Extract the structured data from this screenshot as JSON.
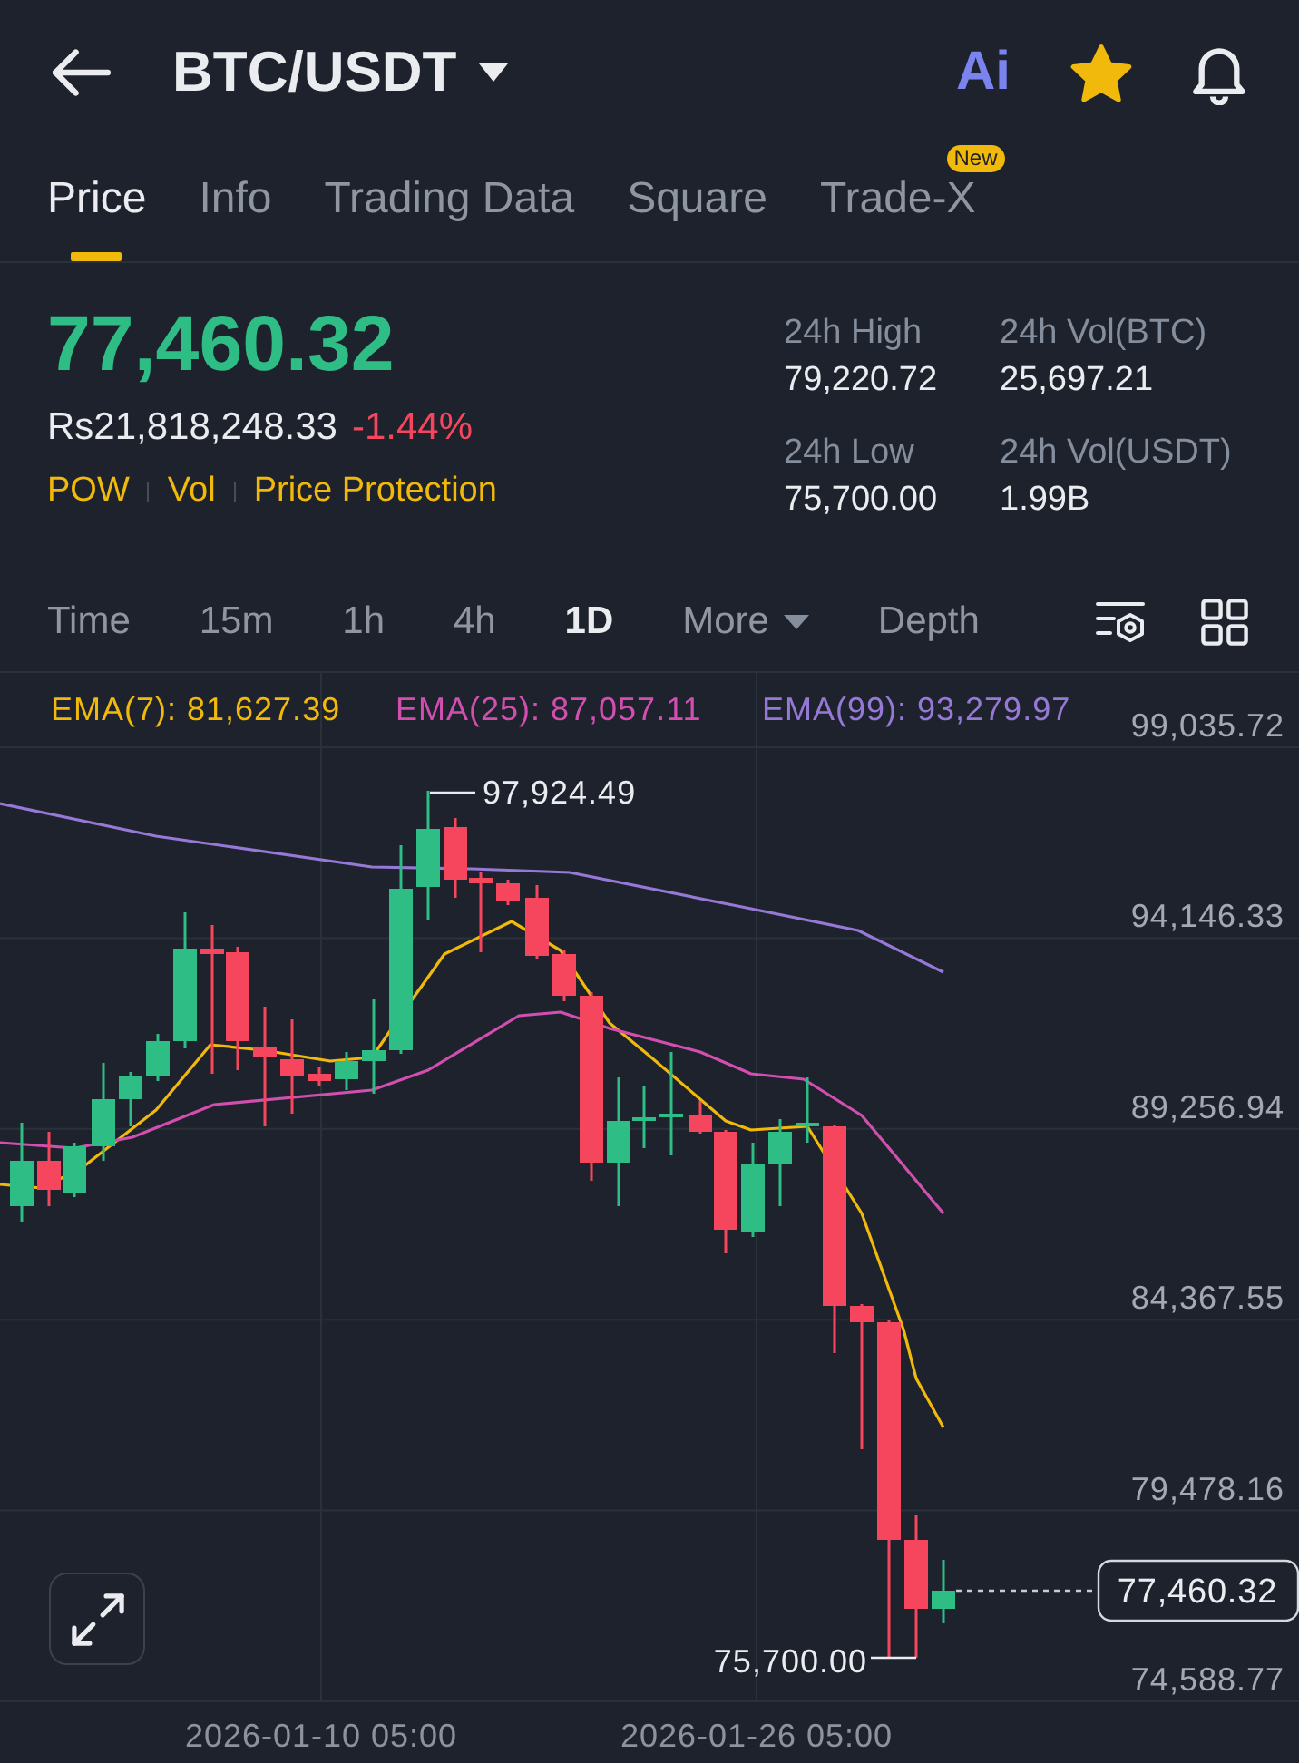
{
  "header": {
    "pair": "BTC/USDT",
    "ai_label": "Ai",
    "favorite": true
  },
  "tabs": [
    {
      "label": "Price",
      "selected": true
    },
    {
      "label": "Info",
      "selected": false
    },
    {
      "label": "Trading Data",
      "selected": false
    },
    {
      "label": "Square",
      "selected": false
    },
    {
      "label": "Trade-X",
      "selected": false,
      "badge": "New"
    }
  ],
  "ticker": {
    "price": {
      "value": "77,460.32",
      "rising": true
    },
    "fiat_price": "Rs21,818,248.33",
    "change": {
      "value": "-1.44%",
      "rising": false
    },
    "tags": [
      "POW",
      "Vol",
      "Price Protection"
    ],
    "stats": [
      {
        "label": "24h High",
        "value": "79,220.72"
      },
      {
        "label": "24h Vol(BTC)",
        "value": "25,697.21"
      },
      {
        "label": "24h Low",
        "value": "75,700.00"
      },
      {
        "label": "24h Vol(USDT)",
        "value": "1.99B"
      }
    ]
  },
  "intervals": [
    {
      "label": "Time",
      "kind": "option",
      "selected": false
    },
    {
      "label": "15m",
      "kind": "option",
      "selected": false
    },
    {
      "label": "1h",
      "kind": "option",
      "selected": false
    },
    {
      "label": "4h",
      "kind": "option",
      "selected": false
    },
    {
      "label": "1D",
      "kind": "option",
      "selected": true
    },
    {
      "label": "More",
      "kind": "dropdown",
      "selected": false
    },
    {
      "label": "Depth",
      "kind": "option",
      "selected": false
    }
  ],
  "chart": {
    "indicators": [
      {
        "label": "EMA(7): 81,627.39",
        "color": "#f0b90b"
      },
      {
        "label": "EMA(25): 87,057.11",
        "color": "#d24fb0"
      },
      {
        "label": "EMA(99): 93,279.97",
        "color": "#9679d6"
      }
    ],
    "price_axis": [
      "99,035.72",
      "94,146.33",
      "89,256.94",
      "84,367.55",
      "79,478.16",
      "74,588.77"
    ],
    "time_axis": [
      "2026-01-10 05:00",
      "2026-01-26 05:00"
    ],
    "high_marker": "97,924.49",
    "low_marker": "75,700.00",
    "last_price_tag": "77,460.32"
  }
}
